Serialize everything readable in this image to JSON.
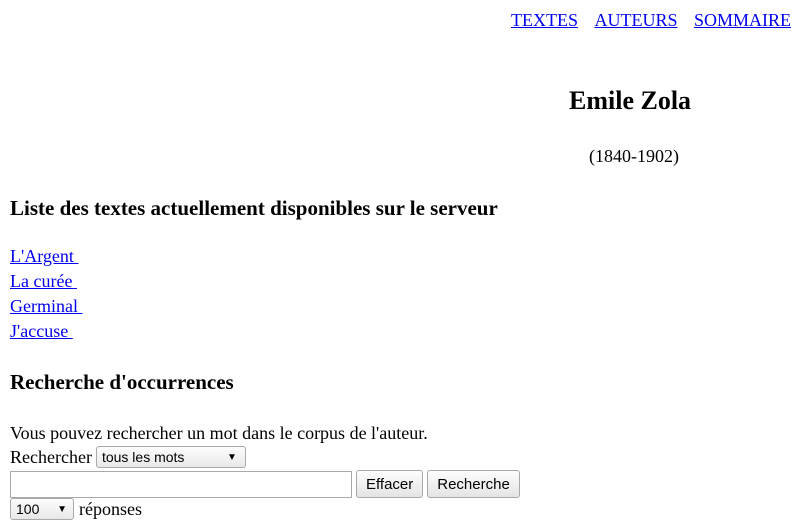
{
  "nav": {
    "textes": "TEXTES",
    "auteurs": "AUTEURS",
    "sommaire": "SOMMAIRE"
  },
  "author": {
    "name": "Emile Zola",
    "dates": "(1840-1902)"
  },
  "texts_section": {
    "heading": "Liste des textes actuellement disponibles sur le serveur",
    "items": [
      {
        "label": "L'Argent "
      },
      {
        "label": "La curée "
      },
      {
        "label": "Germinal "
      },
      {
        "label": "J'accuse "
      }
    ]
  },
  "search_section": {
    "heading": "Recherche d'occurrences",
    "description": "Vous pouvez rechercher un mot dans le corpus de l'auteur.",
    "search_label": "Rechercher",
    "mode_selected": "tous les mots",
    "query_value": "",
    "clear_button": "Effacer",
    "search_button": "Recherche",
    "count_selected": "100",
    "count_suffix": "réponses",
    "dropdown_arrow": "▼"
  }
}
